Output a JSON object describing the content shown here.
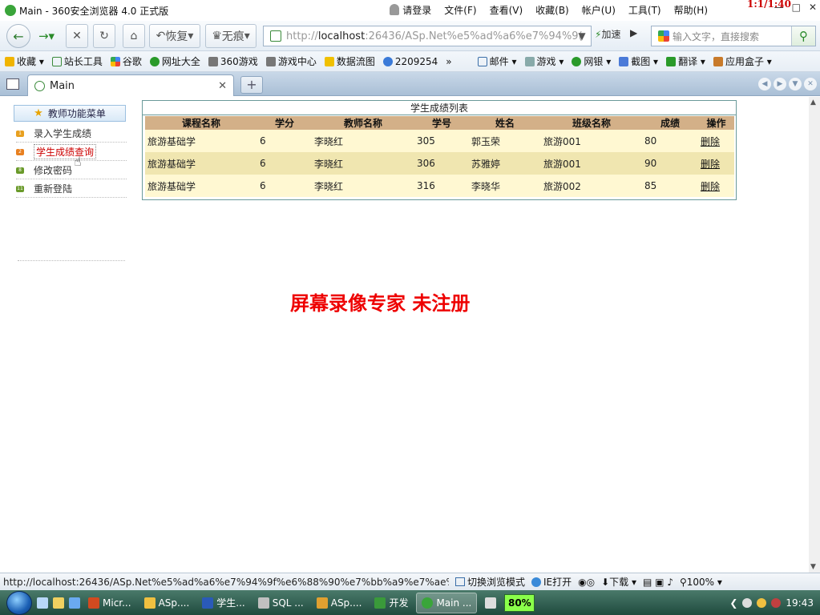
{
  "window": {
    "title": "Main - 360安全浏览器 4.0 正式版",
    "clock_overlay": "1:1/1:40",
    "menus": [
      "请登录",
      "文件(F)",
      "查看(V)",
      "收藏(B)",
      "帐户(U)",
      "工具(T)",
      "帮助(H)"
    ]
  },
  "nav": {
    "restore_label": "恢复",
    "incognito_label": "无痕",
    "address_scheme": "http://",
    "address_host": "localhost",
    "address_rest": ":26436/ASp.Net%e5%ad%a6%e7%94%9(",
    "speed_label": "加速",
    "search_placeholder": "输入文字，直接搜索"
  },
  "bookmarks": {
    "items": [
      "收藏",
      "站长工具",
      "谷歌",
      "网址大全",
      "360游戏",
      "游戏中心",
      "数据流图",
      "2209254",
      "»",
      "邮件",
      "游戏",
      "网银",
      "截图",
      "翻译",
      "应用盒子"
    ]
  },
  "tabs": {
    "active_label": "Main",
    "new_tab": "+"
  },
  "sidebar": {
    "header": "教师功能菜单",
    "items": [
      {
        "num": "1",
        "label": "录入学生成绩"
      },
      {
        "num": "2",
        "label": "学生成绩查询"
      },
      {
        "num": "8",
        "label": "修改密码"
      },
      {
        "num": "11",
        "label": "重新登陆"
      }
    ]
  },
  "grid": {
    "caption": "学生成绩列表",
    "columns": [
      "课程名称",
      "学分",
      "教师名称",
      "学号",
      "姓名",
      "班级名称",
      "成绩",
      "操作"
    ],
    "rows": [
      [
        "旅游基础学",
        "6",
        "李晓红",
        "305",
        "郭玉荣",
        "旅游001",
        "80",
        "删除"
      ],
      [
        "旅游基础学",
        "6",
        "李晓红",
        "306",
        "苏雅婷",
        "旅游001",
        "90",
        "删除"
      ],
      [
        "旅游基础学",
        "6",
        "李晓红",
        "316",
        "李晓华",
        "旅游002",
        "85",
        "删除"
      ]
    ]
  },
  "watermark": "屏幕录像专家  未注册",
  "status": {
    "url": "http://localhost:26436/ASp.Net%e5%ad%a6%e7%94%9f%e6%88%90%e7%bb%a9%e7%ae%...",
    "switch_mode": "切换浏览模式",
    "ie_open": "IE打开",
    "download": "下载",
    "zoom": "100%"
  },
  "taskbar": {
    "items": [
      "Micr...",
      "ASp....",
      "学生...",
      "SQL ...",
      "ASp....",
      "开发",
      "Main ..."
    ],
    "battery": "80%",
    "time": "19:43"
  },
  "colors": {
    "header_row": "#d3b088",
    "row_odd": "#fff8d2",
    "row_even": "#f0e6b0",
    "active_menu": "#cc0000",
    "watermark": "#ee0000"
  }
}
